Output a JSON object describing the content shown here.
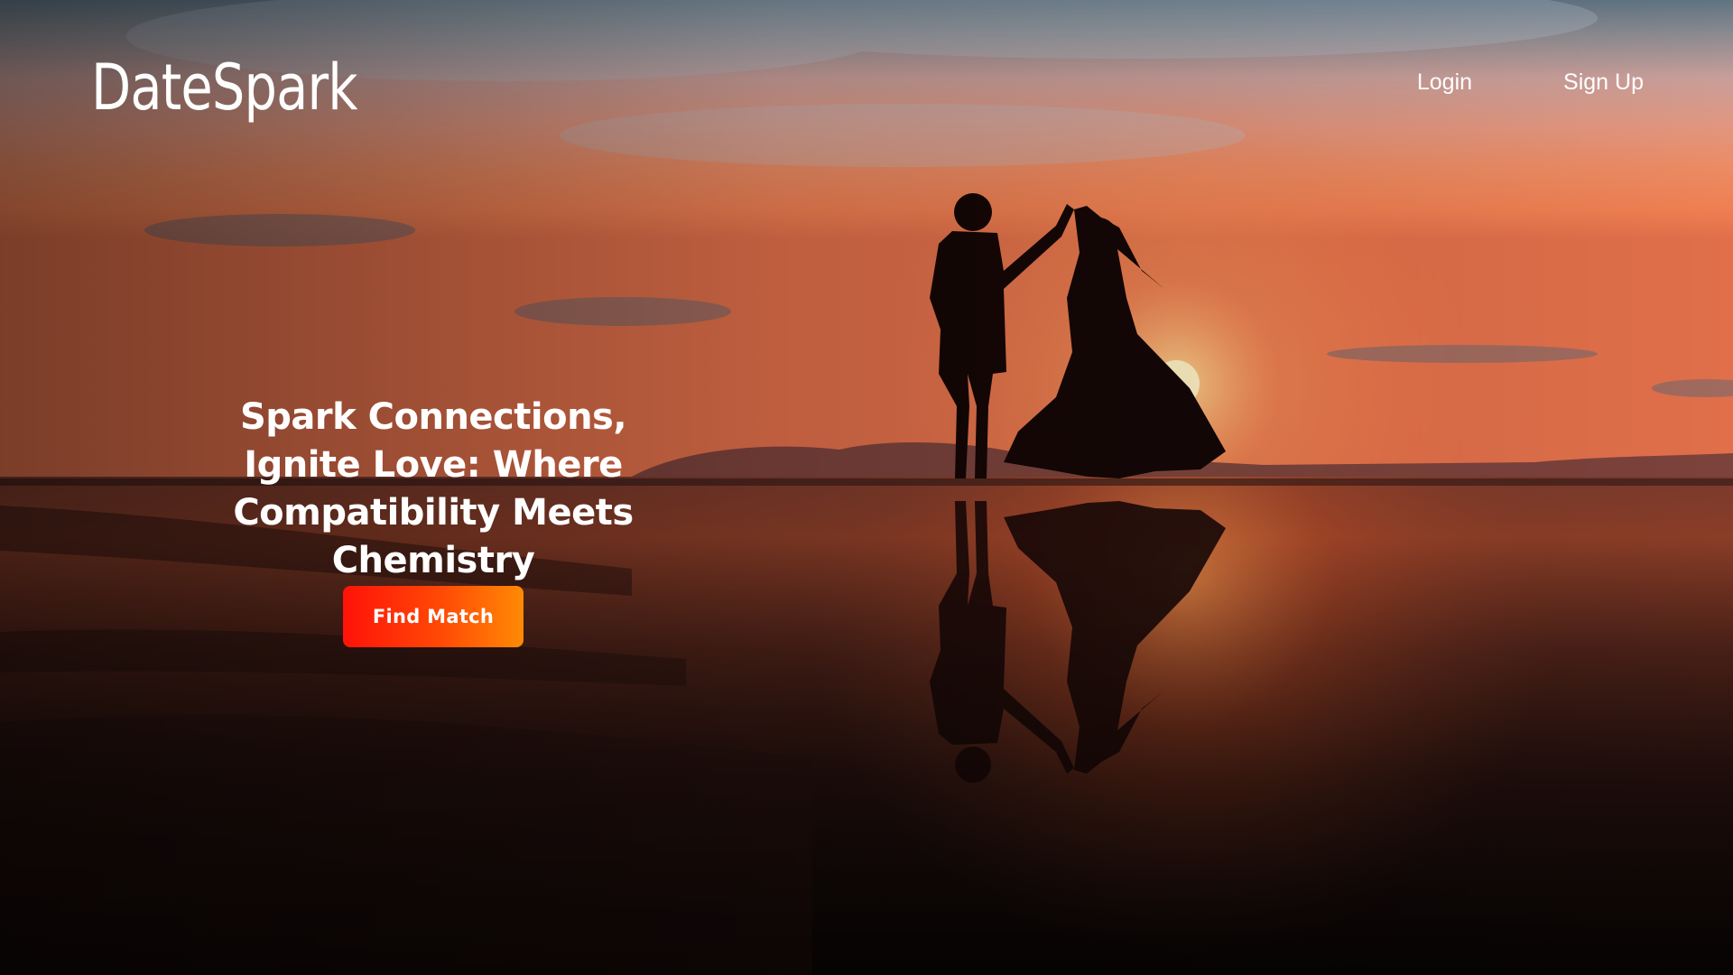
{
  "brand": {
    "name": "DateSpark"
  },
  "nav": {
    "login": "Login",
    "signup": "Sign Up"
  },
  "hero": {
    "headline": "Spark Connections, Ignite Love: Where Compatibility Meets Chemistry",
    "cta_label": "Find Match",
    "background": "sunset-beach-couple-silhouette-photo"
  },
  "colors": {
    "cta_gradient_start": "#ff1208",
    "cta_gradient_end": "#ff8a05",
    "text": "#ffffff"
  }
}
